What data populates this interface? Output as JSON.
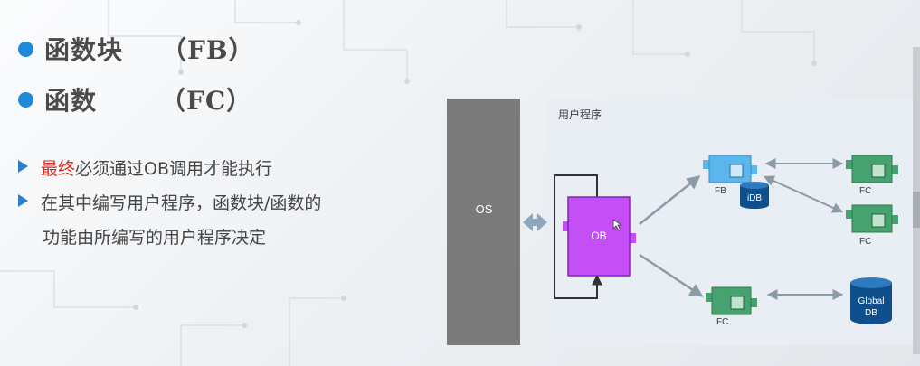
{
  "bullets": [
    {
      "main": "函数块",
      "paren": "（FB）"
    },
    {
      "main": "函数",
      "paren": "（FC）"
    }
  ],
  "points": [
    {
      "highlight": "最终",
      "rest": "必须通过OB调用才能执行"
    },
    {
      "line1": "在其中编写用户程序，函数块/函数的",
      "line2": "功能由所编写的用户程序决定"
    }
  ],
  "diagram": {
    "os_label": "OS",
    "panel_title": "用户程序",
    "ob_label": "OB",
    "fb_label": "FB",
    "idb_label": "iDB",
    "fc_labels": [
      "FC",
      "FC",
      "FC"
    ],
    "global_db_line1": "Global",
    "global_db_line2": "DB"
  },
  "colors": {
    "bullet_blue": "#1f8ad8",
    "highlight_red": "#e0281c",
    "ob_purple": "#c34ff5",
    "fb_blue": "#5bb6ec",
    "fc_green": "#46a26e",
    "db_navy": "#0e4f8c",
    "os_gray": "#7a7a7a"
  }
}
